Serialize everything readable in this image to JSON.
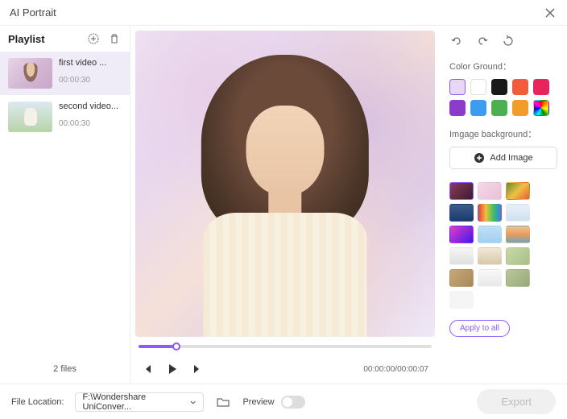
{
  "header": {
    "title": "AI Portrait"
  },
  "playlist": {
    "title": "Playlist",
    "items": [
      {
        "name": "first video ...",
        "duration": "00:00:30"
      },
      {
        "name": "second video...",
        "duration": "00:00:30"
      }
    ],
    "fileCount": "2 files"
  },
  "player": {
    "currentTime": "00:00:00",
    "totalTime": "00:00:07"
  },
  "rightPanel": {
    "colorGroundLabel": "Color Ground：",
    "colorSwatches": [
      {
        "color": "#e8d8f5",
        "selected": true
      },
      {
        "color": "#ffffff",
        "border": "#ddd"
      },
      {
        "color": "#1a1a1a"
      },
      {
        "color": "#f25c3c"
      },
      {
        "color": "#e8245c"
      },
      {
        "color": "#8b3cc8"
      },
      {
        "color": "#3c9cf0"
      },
      {
        "color": "#4cb050"
      },
      {
        "color": "#f29c2c"
      },
      {
        "color": "rainbow"
      }
    ],
    "imageBgLabel": "Imgage background：",
    "addImageLabel": "Add Image",
    "bgThumbs": [
      {
        "bg": "linear-gradient(135deg,#8b3c5c,#3c1a2c)",
        "selected": true
      },
      {
        "bg": "linear-gradient(135deg,#f5d8e8,#e8c0d8)"
      },
      {
        "bg": "linear-gradient(135deg,#5c8c3c,#f0c040,#e85c3c)"
      },
      {
        "bg": "linear-gradient(180deg,#3c5c8c,#1a3c6c)"
      },
      {
        "bg": "linear-gradient(90deg,#e83c3c,#f0c03c,#3cc060,#3c7cf0)"
      },
      {
        "bg": "linear-gradient(180deg,#e8f0f8,#d0e0f0)"
      },
      {
        "bg": "linear-gradient(135deg,#e83cc8,#3c1ae8)"
      },
      {
        "bg": "linear-gradient(180deg,#c0e0f5,#a0d0f0)"
      },
      {
        "bg": "linear-gradient(180deg,#f5c08c,#e89c5c,#6ca8c0)"
      },
      {
        "bg": "linear-gradient(180deg,#f5f5f5,#e0e0e0)"
      },
      {
        "bg": "linear-gradient(180deg,#f0e8d8,#d8c8a8)"
      },
      {
        "bg": "linear-gradient(135deg,#c8d8a8,#a8c088)"
      },
      {
        "bg": "linear-gradient(135deg,#c8a878,#a88858)"
      },
      {
        "bg": "linear-gradient(180deg,#f8f8f8,#e8e8e8)"
      },
      {
        "bg": "linear-gradient(135deg,#b8c898,#98a878)"
      },
      {
        "bg": "#f5f5f5"
      }
    ],
    "applyLabel": "Apply to all"
  },
  "footer": {
    "locationLabel": "File Location:",
    "locationValue": "F:\\Wondershare UniConver...",
    "previewLabel": "Preview",
    "exportLabel": "Export"
  }
}
